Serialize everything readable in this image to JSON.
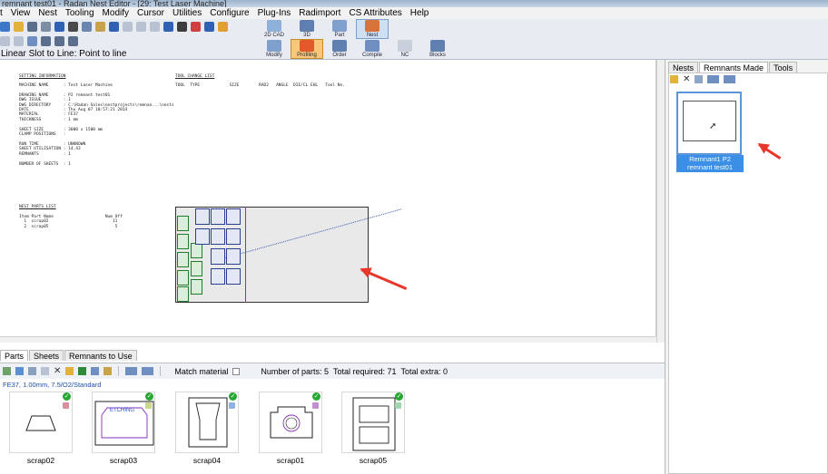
{
  "window": {
    "title": "remnant test01 - Radan Nest Editor - [29: Test Laser Machine]"
  },
  "menu": [
    "t",
    "View",
    "Nest",
    "Tooling",
    "Modify",
    "Cursor",
    "Utilities",
    "Configure",
    "Plug-Ins",
    "Radimport",
    "CS Attributes",
    "Help"
  ],
  "status": {
    "prompt": "Linear Slot to Line: Point to line"
  },
  "big_tools": [
    {
      "label": "2D CAD"
    },
    {
      "label": "3D"
    },
    {
      "label": "Part"
    },
    {
      "label": "Nest"
    },
    {
      "label": "Modify"
    },
    {
      "label": "Profiling"
    },
    {
      "label": "Order"
    },
    {
      "label": "Compile"
    },
    {
      "label": "NC"
    },
    {
      "label": "Blocks"
    }
  ],
  "report": {
    "setting_header": "SETTING INFORMATION",
    "setting_lines": "MACHINE NAME      : Test Laser Machine\n\nDRAWING NAME      : P2 remnant test01\nDWG ISSUE         : 1\nDWG DIRECTORY     : C:\\Radan Sales\\nestprojects\\remnan...\\nests\nDATE              : Thu Aug 07 10:57:21 2014\nMATERIAL          : FE37\nTHICKNESS         : 1 mm\n\nSHEET SIZE        : 3000 x 1500 mm\nCLAMP POSITIONS   :\n\nRUN TIME          : UNKNOWN\nSHEET UTILISATION : 14.43\nREMNANTS          : 1\n\nNUMBER OF SHEETS  : 1",
    "tool_header": "TOOL CHANGE LIST",
    "tool_columns": "TOOL  TYPE            SIZE        RAD2   ANGLE  DIE/CL EHL   Tool No.",
    "parts_header": "NEST PARTS LIST",
    "parts_lines": "Item Part Name                     Num Off\n  1  scrap02                          11\n  2  scrap05                           5"
  },
  "right_panel": {
    "tabs": [
      "Nests",
      "Remnants Made",
      "Tools"
    ],
    "active_tab": "Remnants Made",
    "remnant_label": "Remnant1 P2 remnant test01"
  },
  "bottom": {
    "tabs": [
      "Parts",
      "Sheets",
      "Remnants to Use"
    ],
    "active_tab": "Parts",
    "match_material_label": "Match material",
    "num_parts": "Number of parts: 5",
    "total_required": "Total required: 71",
    "total_extra": "Total extra: 0",
    "material_line": "FE37, 1.00mm, 7.5/O2/Standard",
    "parts": [
      {
        "name": "scrap02",
        "swatch": "#d98f9d"
      },
      {
        "name": "scrap03",
        "swatch": "#c9d88a",
        "etch": "ETCHING"
      },
      {
        "name": "scrap04",
        "swatch": "#8fb3e0"
      },
      {
        "name": "scrap01",
        "swatch": "#c38fd0"
      },
      {
        "name": "scrap05",
        "swatch": "#9fd8b0"
      }
    ]
  },
  "colors": {
    "accent": "#3b8fe6",
    "arrow": "#e8362b",
    "check": "#27a832"
  }
}
